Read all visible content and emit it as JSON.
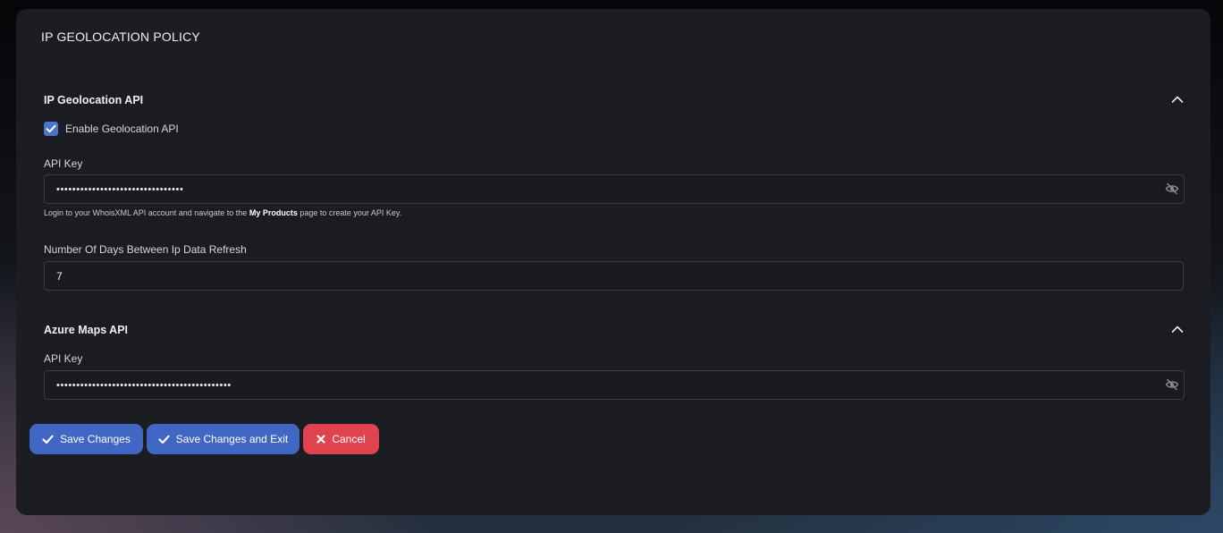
{
  "page": {
    "title": "IP GEOLOCATION POLICY"
  },
  "geolocation": {
    "title": "IP Geolocation API",
    "enable_label": "Enable Geolocation API",
    "enabled": true,
    "api_key_label": "API Key",
    "api_key_value": "••••••••••••••••••••••••••••••••",
    "help_prefix": "Login to your WhoisXML API account and navigate to the",
    "help_link": "My Products",
    "help_suffix": "page to create your API Key.",
    "refresh_label": "Number Of Days Between Ip Data Refresh",
    "refresh_value": "7"
  },
  "azure": {
    "title": "Azure Maps API",
    "api_key_label": "API Key",
    "api_key_value": "••••••••••••••••••••••••••••••••••••••••••••"
  },
  "actions": {
    "save_label": "Save Changes",
    "save_exit_label": "Save Changes and Exit",
    "cancel_label": "Cancel"
  },
  "colors": {
    "primary": "#4067c3",
    "danger": "#e0434e",
    "checkbox": "#4a74c9"
  }
}
